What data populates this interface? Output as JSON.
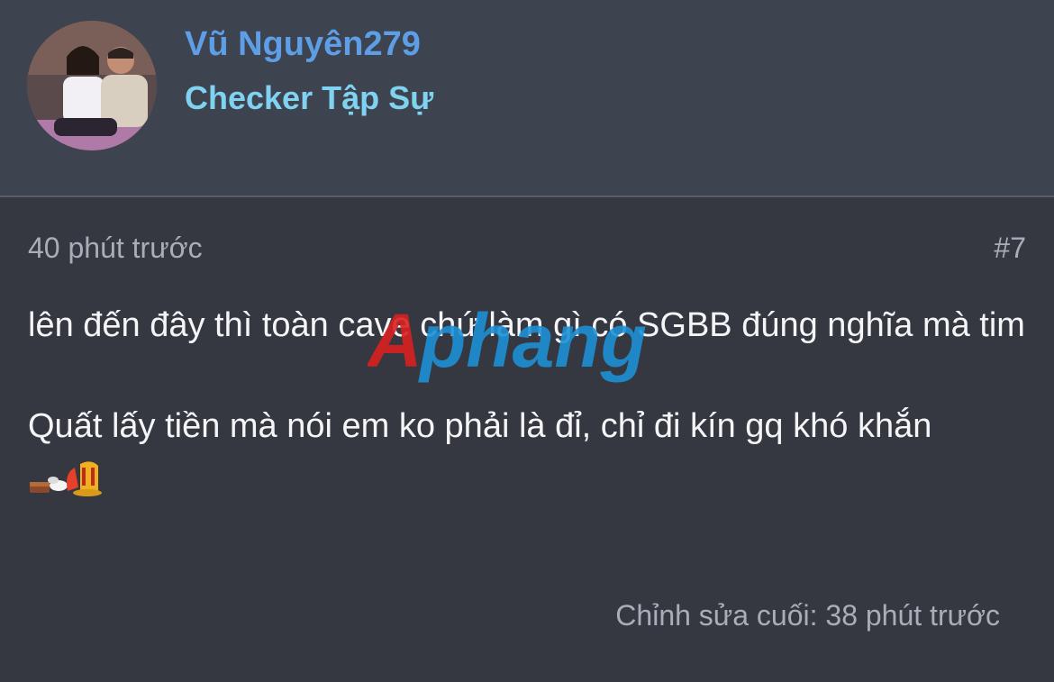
{
  "user": {
    "name": "Vũ Nguyên279",
    "rank": "Checker Tập Sự"
  },
  "post": {
    "timestamp": "40 phút trước",
    "number": "#7",
    "paragraphs": [
      "lên đến đây thì toàn cave chứ làm gì có SGBB đúng nghĩa mà tim",
      "Quất lấy tiền mà nói em ko phải là đỉ, chỉ đi kín gq khó khắn"
    ],
    "emoji": "smoking-emoticon-icon",
    "edited": "Chỉnh sửa cuối: 38 phút trước"
  },
  "watermark": {
    "text": "Aphang",
    "colors": {
      "first_letter": "#d82020",
      "rest": "#1e90d6"
    }
  },
  "colors": {
    "header_bg": "#3e4350",
    "body_bg": "#353841",
    "username": "#5d9ee6",
    "rank": "#7fd2f0",
    "meta_text": "#a9adb6",
    "content_text": "#f4f5f7"
  }
}
